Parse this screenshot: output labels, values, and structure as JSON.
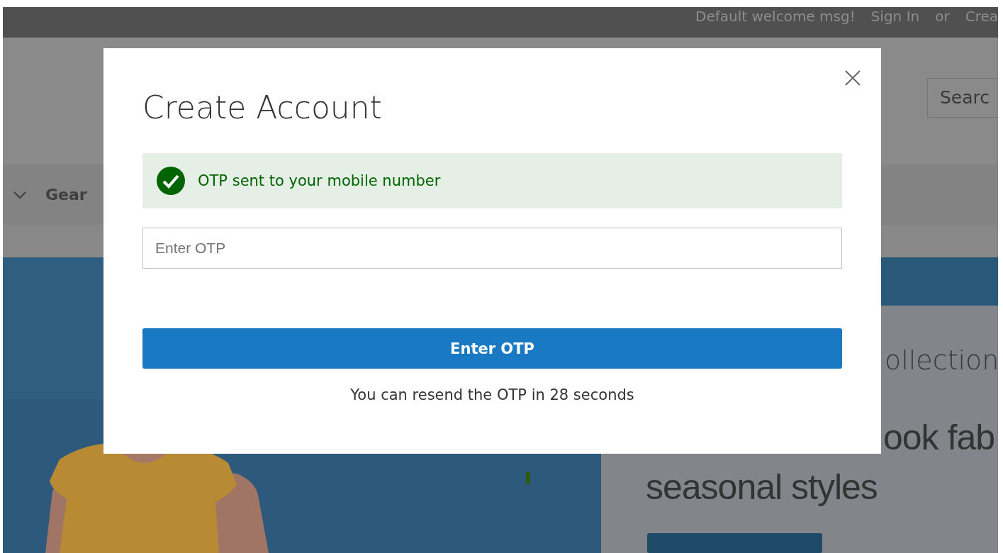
{
  "top_bar": {
    "welcome": "Default welcome msg!",
    "sign_in": "Sign In",
    "or": "or",
    "create": "Crea"
  },
  "header": {
    "search": {
      "placeholder": "Searc"
    }
  },
  "nav": {
    "items": [
      {
        "label": "Gear"
      }
    ]
  },
  "hero": {
    "subtitle": "ollection",
    "headline_lines": [
      "ook fab",
      "seasonal styles"
    ]
  },
  "modal": {
    "title": "Create Account",
    "message": {
      "kind": "success",
      "text": "OTP sent to your mobile number"
    },
    "otp_field": {
      "placeholder": "Enter OTP"
    },
    "submit_button": "Enter OTP",
    "resend_note": "You can resend the OTP in 28 seconds"
  }
}
